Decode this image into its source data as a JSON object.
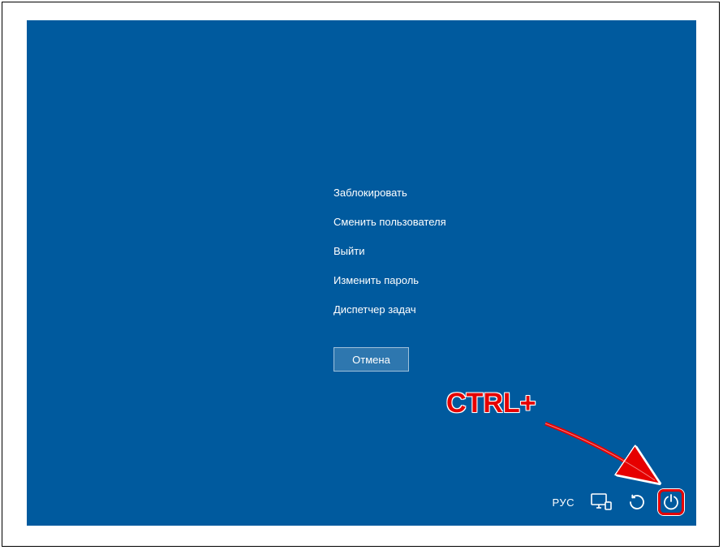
{
  "menu": {
    "lock": "Заблокировать",
    "switch_user": "Сменить пользователя",
    "sign_out": "Выйти",
    "change_password": "Изменить пароль",
    "task_manager": "Диспетчер задач"
  },
  "cancel": "Отмена",
  "taskbar": {
    "language": "РУС"
  },
  "annotation": {
    "label": "CTRL+"
  }
}
